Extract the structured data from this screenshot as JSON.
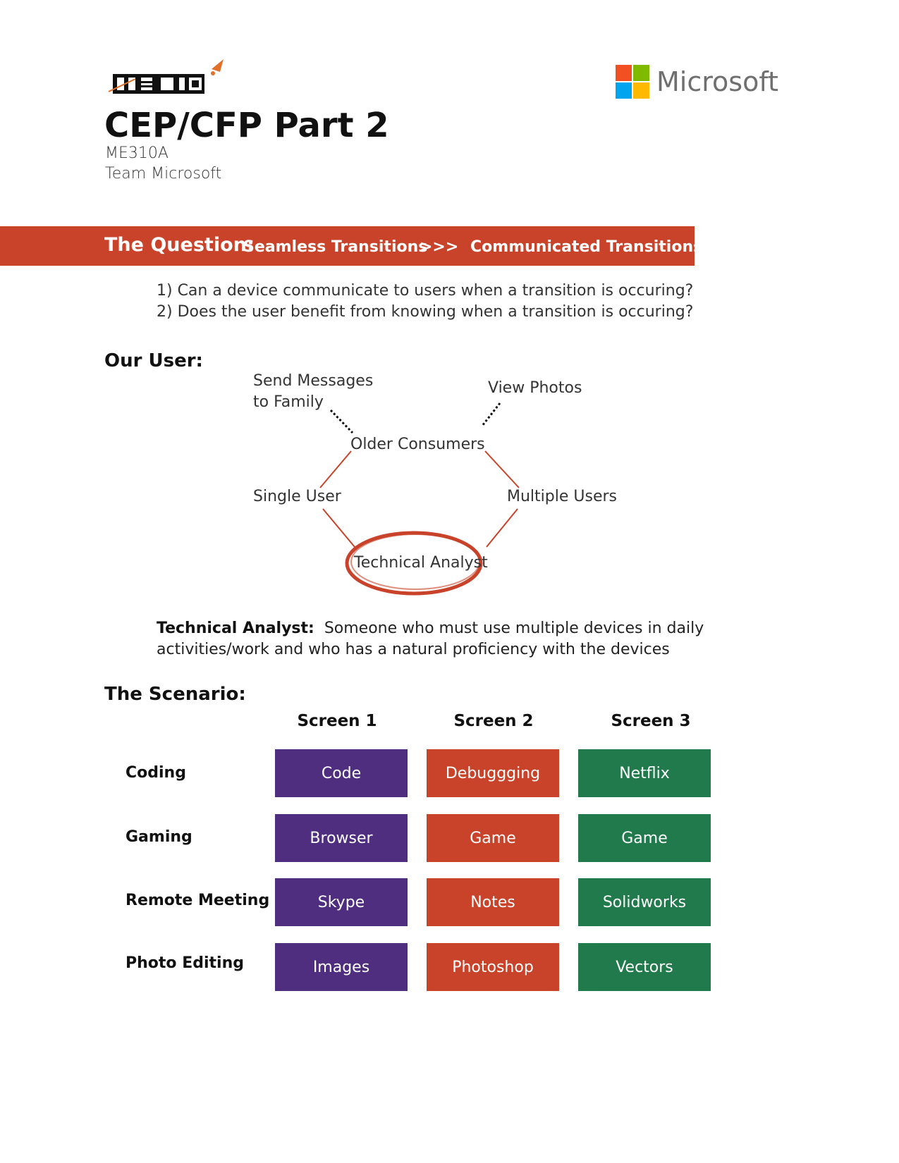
{
  "logos": {
    "me310": {
      "name": "ME310 rocket logo",
      "lettering": "ME310"
    },
    "microsoft": {
      "wordmark": "Microsoft",
      "tile_colors": [
        "#f25022",
        "#7fba00",
        "#00a4ef",
        "#ffb900"
      ]
    }
  },
  "header": {
    "title": "CEP/CFP Part 2",
    "course": "ME310A",
    "team": "Team Microsoft"
  },
  "question_banner": {
    "label": "The Question:",
    "from": "Seamless Transitions",
    "arrow": ">>>",
    "to": "Communicated Transitions",
    "color": "#c8432a"
  },
  "questions": [
    "1) Can a device communicate to users when a transition is occuring?",
    "2) Does the user benefit from knowing when a transition is occuring?"
  ],
  "our_user": {
    "heading": "Our User:",
    "nodes": {
      "send_line1": "Send Messages",
      "send_line2": "to Family",
      "view_photos": "View Photos",
      "older_consumers": "Older Consumers",
      "single_user": "Single User",
      "multiple_users": "Multiple Users",
      "technical_analyst": "Technical Analyst"
    },
    "highlighted": "Technical Analyst",
    "definition_term": "Technical Analyst:",
    "definition_text": "Someone who must use multiple devices in daily activities/work and who has a natural proficiency with the devices"
  },
  "scenario": {
    "heading": "The Scenario:",
    "columns": [
      "Screen 1",
      "Screen 2",
      "Screen 3"
    ],
    "column_colors": [
      "#4f2d7f",
      "#c8432a",
      "#217a4b"
    ],
    "rows": [
      {
        "label": "Coding",
        "cells": [
          "Code",
          "Debuggging",
          "Netflix"
        ]
      },
      {
        "label": "Gaming",
        "cells": [
          "Browser",
          "Game",
          "Game"
        ]
      },
      {
        "label": "Remote Meeting",
        "cells": [
          "Skype",
          "Notes",
          "Solidworks"
        ]
      },
      {
        "label": "Photo Editing",
        "cells": [
          "Images",
          "Photoshop",
          "Vectors"
        ]
      }
    ]
  }
}
